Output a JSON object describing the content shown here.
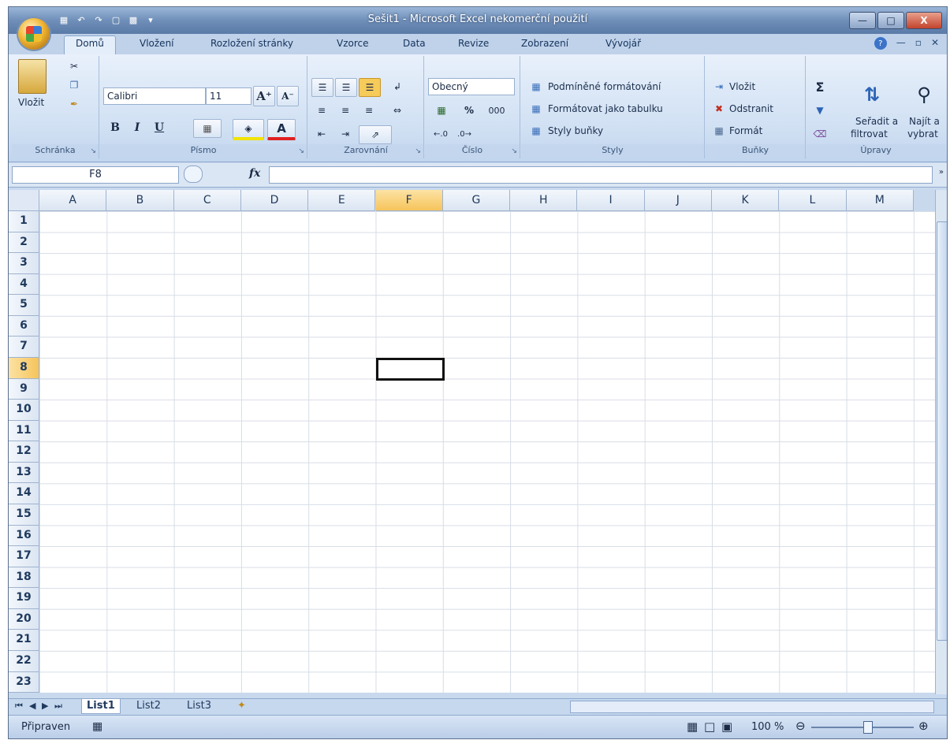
{
  "window": {
    "title": "Sešit1 - Microsoft Excel nekomerční použití"
  },
  "tabs": [
    "Domů",
    "Vložení",
    "Rozložení stránky",
    "Vzorce",
    "Data",
    "Revize",
    "Zobrazení",
    "Vývojář"
  ],
  "ribbon": {
    "clipboard": {
      "paste": "Vložit",
      "label": "Schránka"
    },
    "font": {
      "name": "Calibri",
      "size": "11",
      "bold": "B",
      "italic": "I",
      "underline": "U",
      "label": "Písmo"
    },
    "alignment": {
      "label": "Zarovnání"
    },
    "number": {
      "format": "Obecný",
      "percent": "%",
      "thousands": "000",
      "label": "Číslo"
    },
    "styles": {
      "conditional": "Podmíněné formátování",
      "table": "Formátovat jako tabulku",
      "cell": "Styly buňky",
      "label": "Styly"
    },
    "cells": {
      "insert": "Vložit",
      "delete": "Odstranit",
      "format": "Formát",
      "label": "Buňky"
    },
    "editing": {
      "sum": "Σ",
      "sort_line1": "Seřadit a",
      "sort_line2": "filtrovat",
      "find_line1": "Najít a",
      "find_line2": "vybrat",
      "label": "Úpravy"
    }
  },
  "formula_bar": {
    "name_box": "F8",
    "fx": "fx",
    "formula": ""
  },
  "grid": {
    "columns": [
      "A",
      "B",
      "C",
      "D",
      "E",
      "F",
      "G",
      "H",
      "I",
      "J",
      "K",
      "L",
      "M"
    ],
    "rows": [
      "1",
      "2",
      "3",
      "4",
      "5",
      "6",
      "7",
      "8",
      "9",
      "10",
      "11",
      "12",
      "13",
      "14",
      "15",
      "16",
      "17",
      "18",
      "19",
      "20",
      "21",
      "22",
      "23"
    ],
    "selected_column": "F",
    "selected_row": "8"
  },
  "sheets": [
    "List1",
    "List2",
    "List3"
  ],
  "status": {
    "text": "Připraven",
    "zoom": "100 %"
  }
}
